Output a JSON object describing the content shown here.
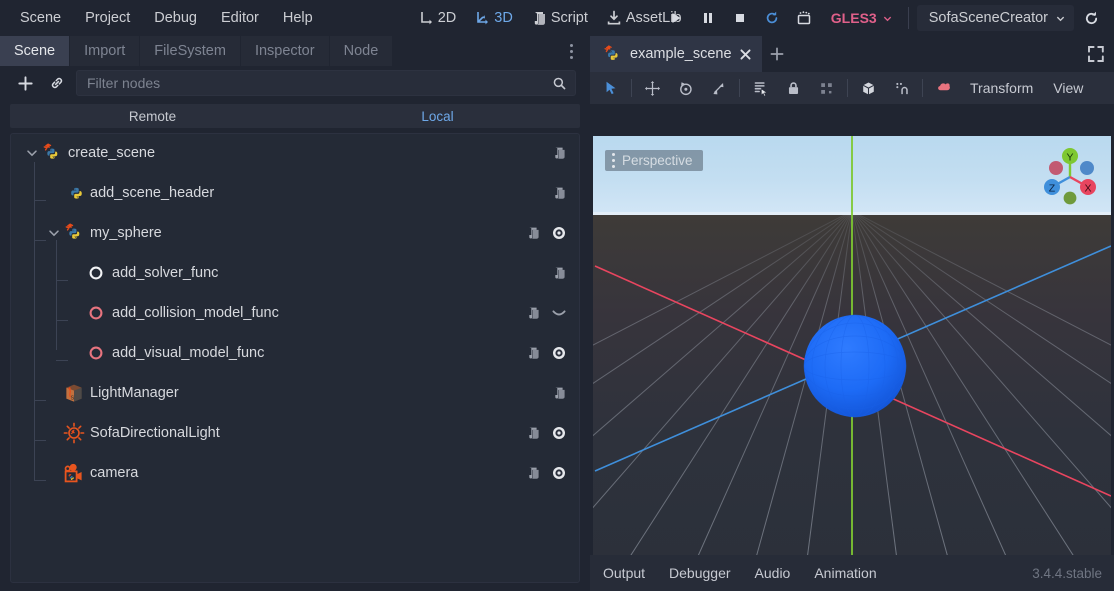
{
  "menubar": {
    "items": [
      "Scene",
      "Project",
      "Debug",
      "Editor",
      "Help"
    ],
    "modes": [
      {
        "label": "2D",
        "icon": "move-2d-icon",
        "active": false
      },
      {
        "label": "3D",
        "icon": "move-3d-icon",
        "active": true
      },
      {
        "label": "Script",
        "icon": "script-icon",
        "active": false
      },
      {
        "label": "AssetLib",
        "icon": "download-icon",
        "active": false
      }
    ],
    "playback": [
      {
        "name": "play-button",
        "icon": "play-icon"
      },
      {
        "name": "pause-button",
        "icon": "pause-icon"
      },
      {
        "name": "stop-button",
        "icon": "stop-icon"
      },
      {
        "name": "play-scene-button",
        "icon": "reload-icon"
      },
      {
        "name": "play-custom-scene-button",
        "icon": "movie-icon"
      }
    ],
    "renderer": "GLES3",
    "project": "SofaSceneCreator",
    "reload_icon": "reload-icon"
  },
  "left_dock": {
    "tabs": [
      {
        "label": "Scene",
        "active": true
      },
      {
        "label": "Import",
        "active": false
      },
      {
        "label": "FileSystem",
        "active": false
      },
      {
        "label": "Inspector",
        "active": false
      },
      {
        "label": "Node",
        "active": false
      }
    ],
    "menu_icon": "vertical-dots-icon",
    "toolbar": {
      "add_icon": "plus-icon",
      "link_icon": "link-icon",
      "search_icon": "search-icon"
    },
    "filter": {
      "placeholder": "Filter nodes",
      "value": ""
    },
    "remote_local": {
      "remote_label": "Remote",
      "local_label": "Local",
      "selected": "Local"
    },
    "tree": [
      {
        "label": "create_scene",
        "depth": 0,
        "icon": "python-node-icon",
        "expander": "chevron-down-icon",
        "script": true,
        "visibility": "none"
      },
      {
        "label": "add_scene_header",
        "depth": 1,
        "icon": "python-icon",
        "expander": "none",
        "script": true,
        "visibility": "none"
      },
      {
        "label": "my_sphere",
        "depth": 1,
        "icon": "python-node-icon",
        "expander": "chevron-down-icon",
        "script": true,
        "visibility": "visible"
      },
      {
        "label": "add_solver_func",
        "depth": 2,
        "icon": "circle-white-icon",
        "expander": "none",
        "script": true,
        "visibility": "none"
      },
      {
        "label": "add_collision_model_func",
        "depth": 2,
        "icon": "circle-red-icon",
        "expander": "none",
        "script": true,
        "visibility": "hidden"
      },
      {
        "label": "add_visual_model_func",
        "depth": 2,
        "icon": "circle-red-icon",
        "expander": "none",
        "script": true,
        "visibility": "visible"
      },
      {
        "label": "LightManager",
        "depth": 1,
        "icon": "mesh-box-icon",
        "expander": "none",
        "script": true,
        "visibility": "none"
      },
      {
        "label": "SofaDirectionalLight",
        "depth": 1,
        "icon": "light-icon",
        "expander": "none",
        "script": true,
        "visibility": "visible"
      },
      {
        "label": "camera",
        "depth": 1,
        "icon": "camera-icon",
        "expander": "none",
        "script": true,
        "visibility": "visible"
      }
    ]
  },
  "right_dock": {
    "scene_tab": {
      "label": "example_scene",
      "icon": "python-node-icon",
      "close_icon": "close-icon"
    },
    "add_tab_icon": "plus-icon",
    "expand_icon": "fullscreen-icon",
    "viewport_toolbar": [
      {
        "name": "select-mode-button",
        "icon": "cursor-arrow-icon",
        "active": true
      },
      {
        "name": "separator",
        "icon": "separator"
      },
      {
        "name": "move-mode-button",
        "icon": "move-icon",
        "active": false
      },
      {
        "name": "rotate-mode-button",
        "icon": "rotate-icon",
        "active": false
      },
      {
        "name": "scale-mode-button",
        "icon": "scale-icon",
        "active": false
      },
      {
        "name": "separator",
        "icon": "separator"
      },
      {
        "name": "list-select-button",
        "icon": "list-select-icon",
        "active": false
      },
      {
        "name": "lock-button",
        "icon": "lock-icon",
        "active": false
      },
      {
        "name": "group-button",
        "icon": "group-icon",
        "active": false
      },
      {
        "name": "separator",
        "icon": "separator"
      },
      {
        "name": "local-space-button",
        "icon": "cube-icon",
        "active": false
      },
      {
        "name": "snap-button",
        "icon": "snap-magnet-icon",
        "active": false
      },
      {
        "name": "separator",
        "icon": "separator"
      },
      {
        "name": "preview-sun-button",
        "icon": "sun-cloud-icon",
        "active": false
      }
    ],
    "viewport_menus": [
      "Transform",
      "View"
    ],
    "viewport": {
      "perspective_label": "Perspective",
      "perspective_menu_icon": "vertical-dots-icon",
      "gizmo_axes": [
        {
          "label": "Y",
          "color": "#7ec832"
        },
        {
          "label": "Z",
          "color": "#3f8fdb"
        },
        {
          "label": "X",
          "color": "#e8455f"
        }
      ],
      "object": "sphere",
      "object_color": "#1863f0"
    },
    "bottom_panels": [
      "Output",
      "Debugger",
      "Audio",
      "Animation"
    ],
    "version": "3.4.4.stable"
  },
  "colors": {
    "accent": "#6ea8e8",
    "renderer": "#e0608a",
    "bg": "#202531",
    "panel": "#242a36",
    "axis_x": "#e8455f",
    "axis_y": "#7ec832",
    "axis_z": "#3f8fdb"
  }
}
